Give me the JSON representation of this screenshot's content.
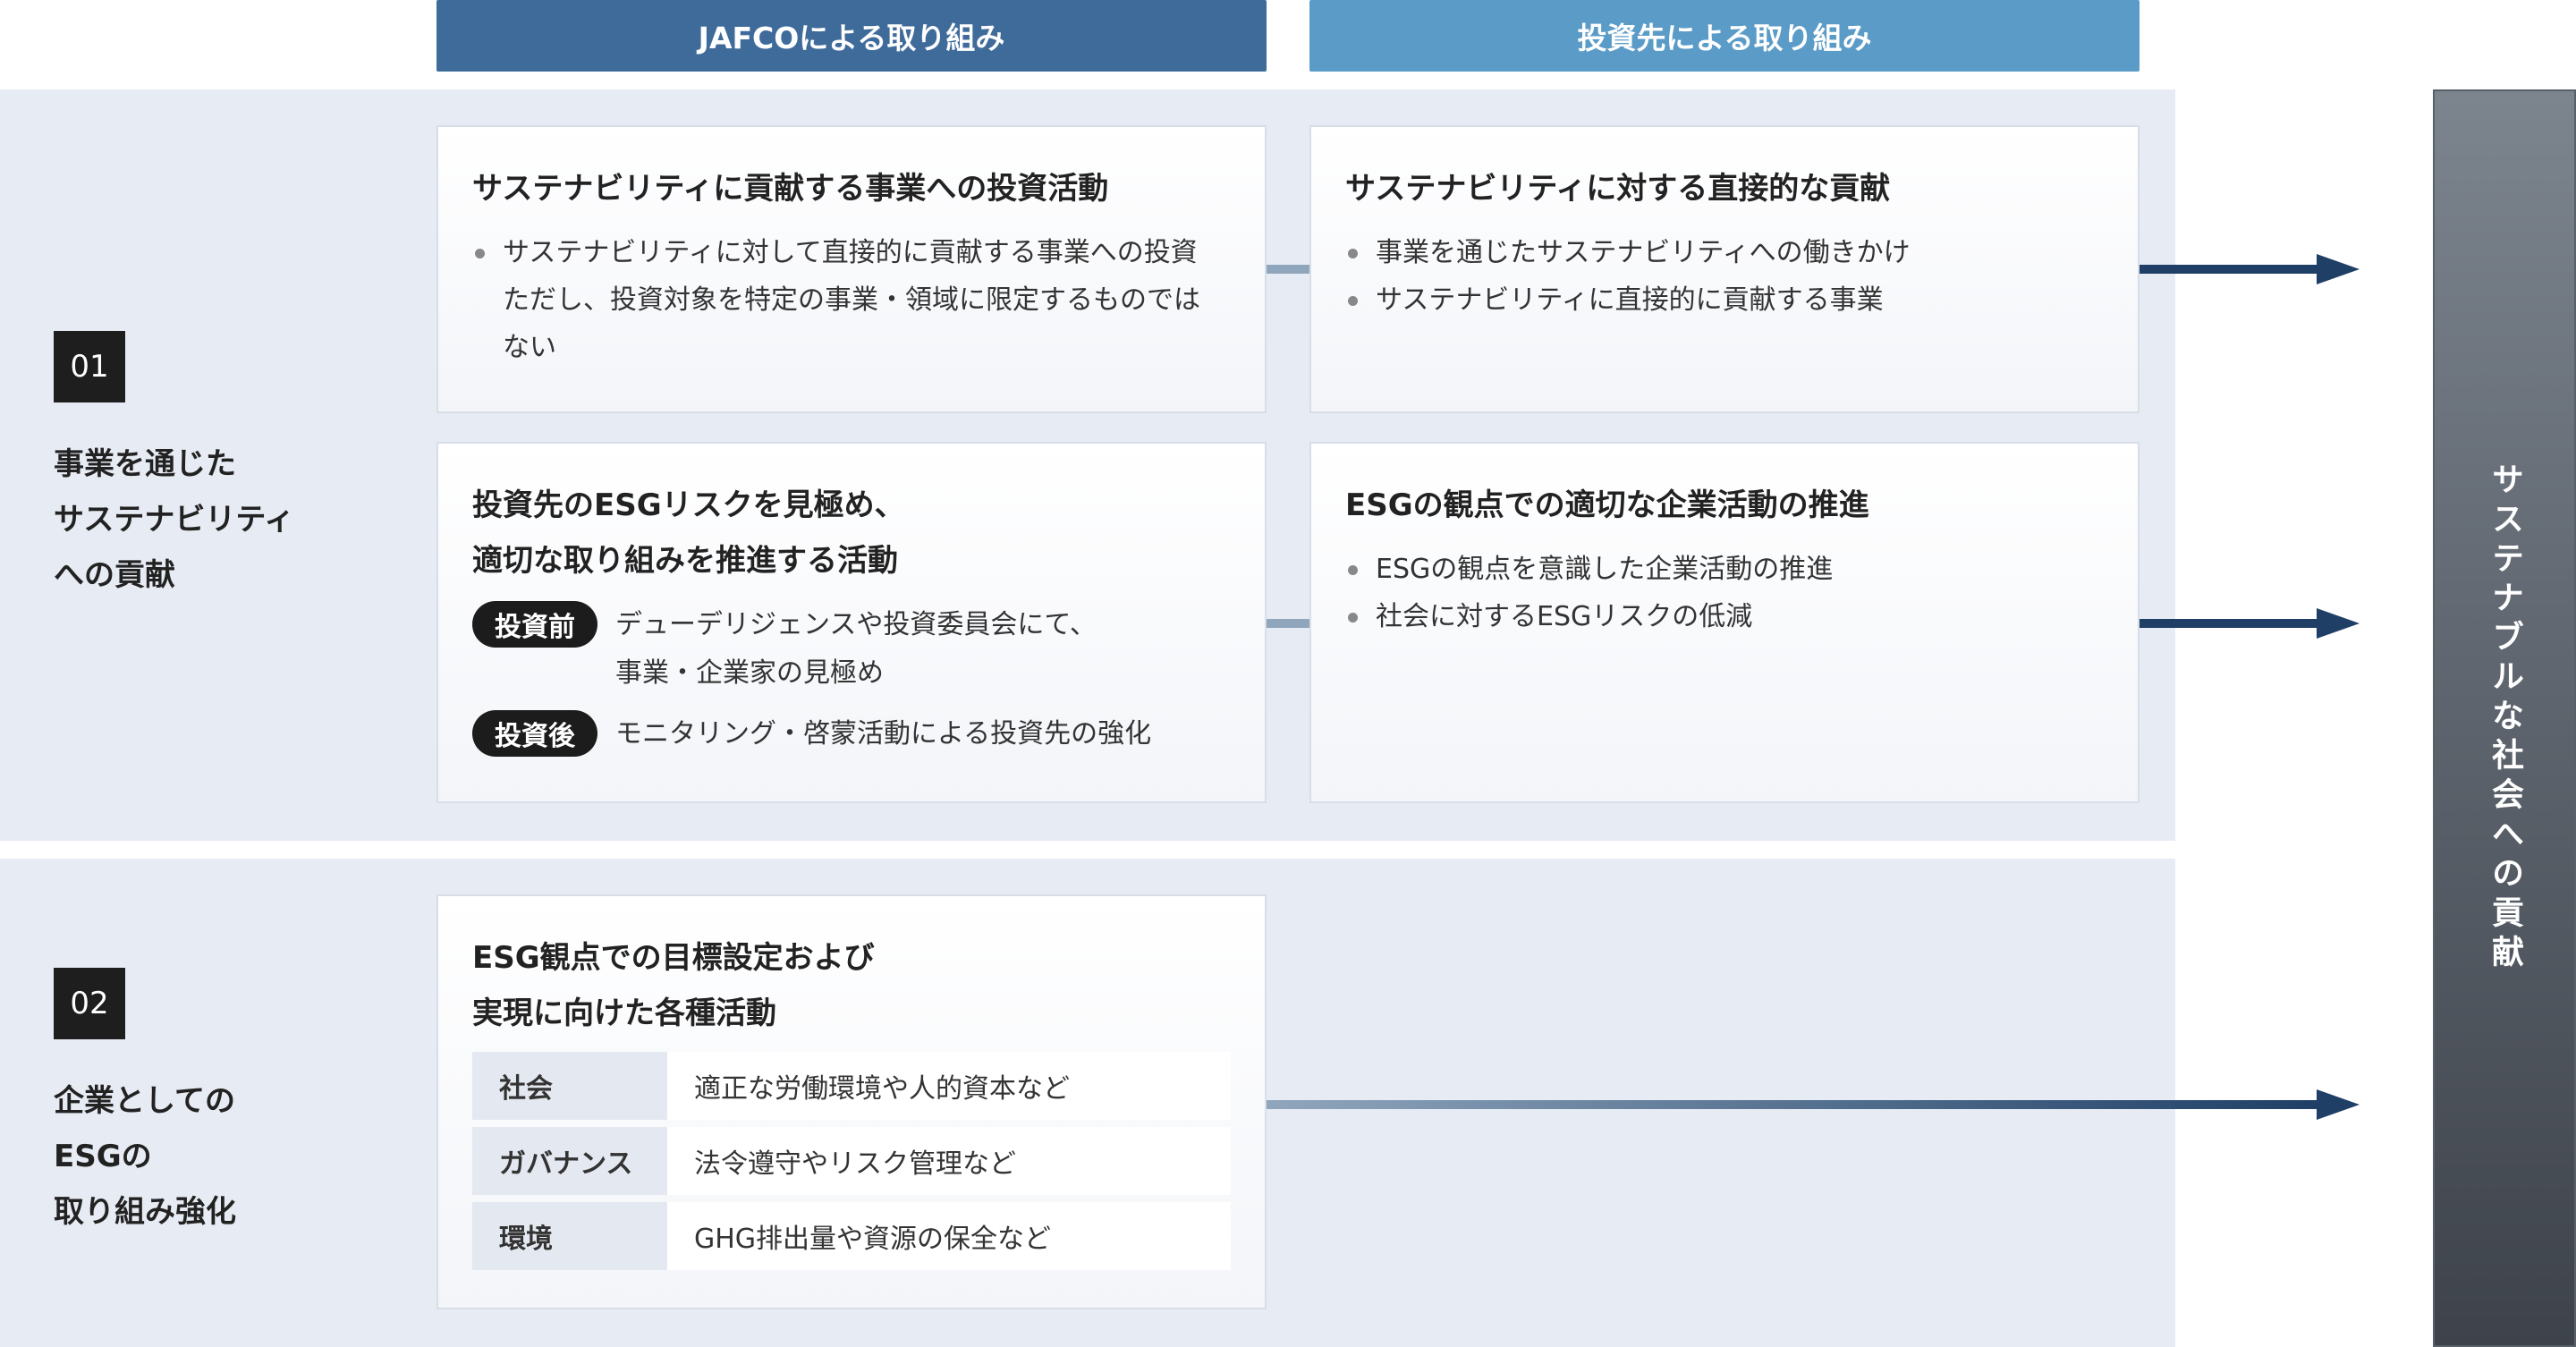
{
  "headers": {
    "jafco": "JAFCOによる取り組み",
    "investee": "投資先による取り組み"
  },
  "rows": [
    {
      "number": "01",
      "label": "事業を通じた\nサステナビリティ\nへの貢献"
    },
    {
      "number": "02",
      "label": "企業としての\nESGの\n取り組み強化"
    }
  ],
  "cards": {
    "c1": {
      "title": "サステナビリティに貢献する事業への投資活動",
      "bullet": "サステナビリティに対して直接的に貢献する事業への投資\nただし、投資対象を特定の事業・領域に限定するものではない"
    },
    "c2": {
      "title": "サステナビリティに対する直接的な貢献",
      "bullets": [
        "事業を通じたサステナビリティへの働きかけ",
        "サステナビリティに直接的に貢献する事業"
      ]
    },
    "c3": {
      "title": "投資先のESGリスクを見極め、\n適切な取り組みを推進する活動",
      "tags": [
        {
          "tag": "投資前",
          "text": "デューデリジェンスや投資委員会にて、\n事業・企業家の見極め"
        },
        {
          "tag": "投資後",
          "text": "モニタリング・啓蒙活動による投資先の強化"
        }
      ]
    },
    "c4": {
      "title": "ESGの観点での適切な企業活動の推進",
      "bullets": [
        "ESGの観点を意識した企業活動の推進",
        "社会に対するESGリスクの低減"
      ]
    },
    "c5": {
      "title": "ESG観点での目標設定および\n実現に向けた各種活動",
      "table": [
        {
          "cat": "社会",
          "text": "適正な労働環境や人的資本など"
        },
        {
          "cat": "ガバナンス",
          "text": "法令遵守やリスク管理など"
        },
        {
          "cat": "環境",
          "text": "GHG排出量や資源の保全など"
        }
      ]
    }
  },
  "goal": "サステナブルな社会への貢献",
  "colors": {
    "header_dark": "#3f6b9b",
    "header_light": "#5b9bc7",
    "arrow": "#1f3f66",
    "band": "#e7ebf3"
  }
}
